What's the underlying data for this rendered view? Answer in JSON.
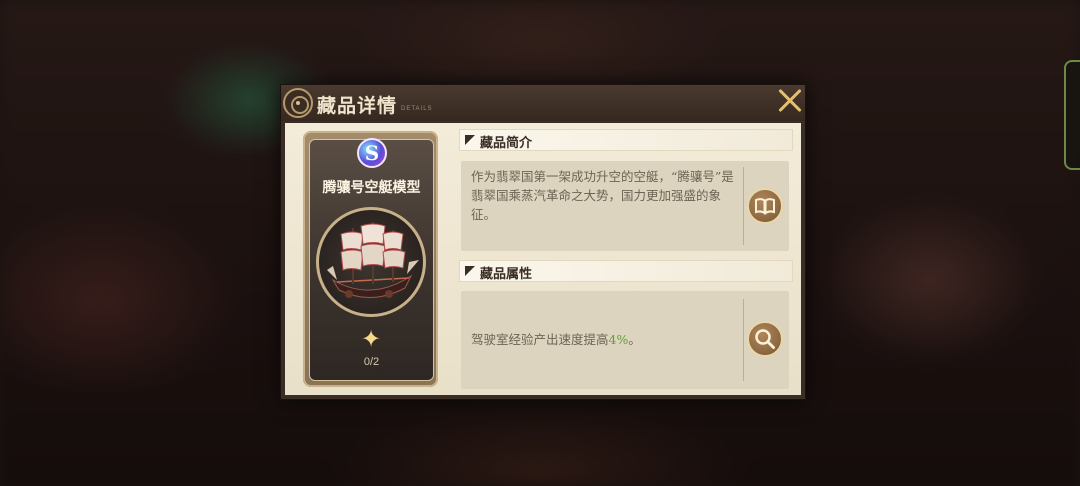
{
  "dialog": {
    "title": "藏品详情",
    "subtitle": "DETAILS"
  },
  "item": {
    "name": "腾骧号空艇模型",
    "rank": "S",
    "stars": "0/2"
  },
  "sections": {
    "intro": {
      "heading": "藏品简介",
      "text": "作为翡翠国第一架成功升空的空艇，“腾骧号”是翡翠国乘蒸汽革命之大势，国力更加强盛的象征。",
      "button_icon": "book-icon"
    },
    "attributes": {
      "heading": "藏品属性",
      "text_prefix": "驾驶室经验产出速度提高",
      "text_value": "4%",
      "text_suffix": "。",
      "button_icon": "magnifier-icon"
    }
  },
  "colors": {
    "accent": "#e4bf6c",
    "highlight": "#5ea13a",
    "panel": "#ddd4c0"
  }
}
